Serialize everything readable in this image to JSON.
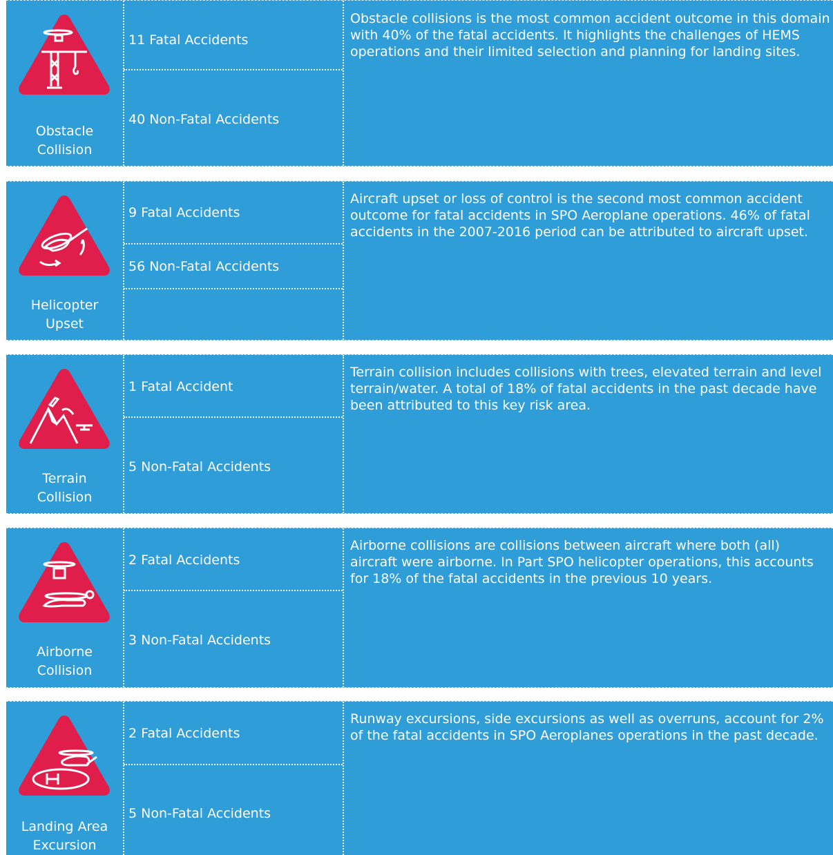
{
  "colors": {
    "panel": "#2e9dd8",
    "triangle": "#e01e4b",
    "text": "#ffffff"
  },
  "rows": [
    {
      "title": "Obstacle Collision",
      "label_line1": "Obstacle",
      "label_line2": "Collision",
      "icon": "crane-helicopter-icon",
      "fatal": "11 Fatal Accidents",
      "non_fatal": "40 Non-Fatal Accidents",
      "description": "Obstacle collisions is the most common accident outcome in this domain with 40% of the fatal accidents. It highlights the challenges of HEMS operations and their limited selection and planning for landing sites."
    },
    {
      "title": "Helicopter Upset",
      "label_line1": "Helicopter",
      "label_line2": "Upset",
      "icon": "helicopter-upset-icon",
      "fatal": "9 Fatal Accidents",
      "non_fatal": "56 Non-Fatal Accidents",
      "description": "Aircraft upset or loss of control is the second most common accident outcome for fatal accidents in SPO Aeroplane operations. 46% of fatal accidents in the 2007-2016 period can be attributed to aircraft upset."
    },
    {
      "title": "Terrain Collision",
      "label_line1": "Terrain",
      "label_line2": "Collision",
      "icon": "mountain-terrain-icon",
      "fatal": "1 Fatal Accident",
      "non_fatal": "5 Non-Fatal Accidents",
      "description": "Terrain collision includes collisions with trees, elevated terrain and level terrain/water. A total of 18% of fatal accidents in the past decade have been attributed to this key risk area."
    },
    {
      "title": "Airborne Collision",
      "label_line1": "Airborne",
      "label_line2": "Collision",
      "icon": "airborne-helicopters-icon",
      "fatal": "2 Fatal Accidents",
      "non_fatal": "3 Non-Fatal Accidents",
      "description": "Airborne collisions are collisions between aircraft where both (all) aircraft were airborne. In Part SPO helicopter operations, this accounts for 18% of the fatal accidents in the previous 10 years."
    },
    {
      "title": "Landing Area Excursion",
      "label_line1": "Landing Area",
      "label_line2": "Excursion",
      "icon": "helipad-landing-icon",
      "fatal": "2 Fatal Accidents",
      "non_fatal": "5 Non-Fatal Accidents",
      "description": "Runway excursions, side excursions as well as overruns, account for 2% of the fatal accidents in SPO Aeroplanes operations in the past decade."
    }
  ]
}
